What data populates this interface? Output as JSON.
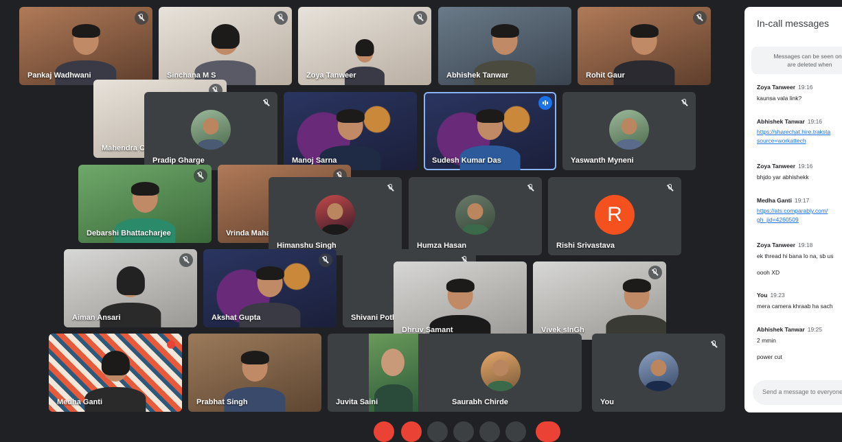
{
  "participants": [
    {
      "name": "Pankaj Wadhwani"
    },
    {
      "name": "Sinchana M S"
    },
    {
      "name": "Zoya Tanweer"
    },
    {
      "name": "Abhishek Tanwar"
    },
    {
      "name": "Rohit Gaur"
    },
    {
      "name": "Mahendra Ch"
    },
    {
      "name": "Pradip Gharge"
    },
    {
      "name": "Manoj Sarna"
    },
    {
      "name": "Sudesh Kumar Das"
    },
    {
      "name": "Yaswanth Myneni"
    },
    {
      "name": "Debarshi Bhattacharjee"
    },
    {
      "name": "Vrinda Maha"
    },
    {
      "name": "Himanshu Singh"
    },
    {
      "name": "Humza Hasan"
    },
    {
      "name": "Rishi Srivastava",
      "initial": "R"
    },
    {
      "name": "Aiman Ansari"
    },
    {
      "name": "Akshat Gupta"
    },
    {
      "name": "Shivani Pothi"
    },
    {
      "name": "Dhruv Samant"
    },
    {
      "name": "Vivek sInGh"
    },
    {
      "name": "Medha Ganti"
    },
    {
      "name": "Prabhat Singh"
    },
    {
      "name": "Juvita Saini"
    },
    {
      "name": "Saurabh Chirde"
    },
    {
      "name": "You"
    }
  ],
  "chat": {
    "title": "In-call messages",
    "notice_line1": "Messages can be seen only",
    "notice_line2": "are deleted when",
    "messages": [
      {
        "sender": "Zoya Tanweer",
        "time": "19:16",
        "lines": [
          "kaunsa vala link?"
        ]
      },
      {
        "sender": "Abhishek Tanwar",
        "time": "19:16",
        "link1": "https://sharechat.hire.traksta",
        "link2": "source=workattech"
      },
      {
        "sender": "Zoya Tanweer",
        "time": "19:16",
        "lines": [
          "bhjdo yar abhishekk"
        ]
      },
      {
        "sender": "Medha Ganti",
        "time": "19:17",
        "link1": "https://ats.comparably.com/",
        "link2": "gh_jid=4260509"
      },
      {
        "sender": "Zoya Tanweer",
        "time": "19:18",
        "lines": [
          "ek thread hi bana lo na, sb us",
          "oooh XD"
        ]
      },
      {
        "sender": "You",
        "time": "19:23",
        "lines": [
          "mera camera khraab ha sach"
        ]
      },
      {
        "sender": "Abhishek Tanwar",
        "time": "19:25",
        "lines": [
          "2 mmin",
          "power cut"
        ]
      }
    ],
    "input_placeholder": "Send a message to everyone"
  },
  "colors": {
    "background": "#202124",
    "tile": "#3c4043",
    "accent": "#1a73e8",
    "speaking_outline": "#8ab4f8",
    "avatar_letter_bg": "#f4511e",
    "recording": "#ea4335"
  }
}
